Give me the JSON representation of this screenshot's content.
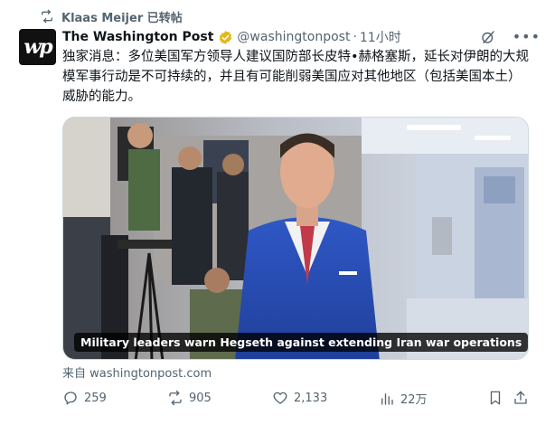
{
  "retweet": {
    "user": "Klaas Meijer",
    "label": "已转帖",
    "icon": "retweet-icon"
  },
  "author": {
    "avatar_text": "wp",
    "display_name": "The Washington Post",
    "verified_icon": "verified-gold-badge-icon",
    "handle": "@washingtonpost",
    "separator": "·",
    "time": "11小时"
  },
  "header_actions": {
    "grok_icon": "grok-icon",
    "more_icon": "more-icon"
  },
  "tweet": {
    "text": "独家消息：多位美国军方领导人建议国防部长皮特•赫格塞斯，延长对伊朗的大规模军事行动是不可持续的，并且有可能削弱美国应对其他地区（包括美国本土）威胁的能力。"
  },
  "card": {
    "title": "Military leaders warn Hegseth against extending Iran war operations",
    "source": "来自 washingtonpost.com"
  },
  "actions": {
    "reply": {
      "icon": "reply-icon",
      "count": "259"
    },
    "retweet": {
      "icon": "retweet-icon",
      "count": "905"
    },
    "like": {
      "icon": "heart-icon",
      "count": "2,133"
    },
    "views": {
      "icon": "views-icon",
      "count": "22万"
    },
    "bookmark": {
      "icon": "bookmark-icon"
    },
    "share": {
      "icon": "share-icon"
    }
  },
  "colors": {
    "text_primary": "#0f1419",
    "text_secondary": "#536471",
    "verified_gold": "#e2b719",
    "border": "#cfd9de"
  }
}
